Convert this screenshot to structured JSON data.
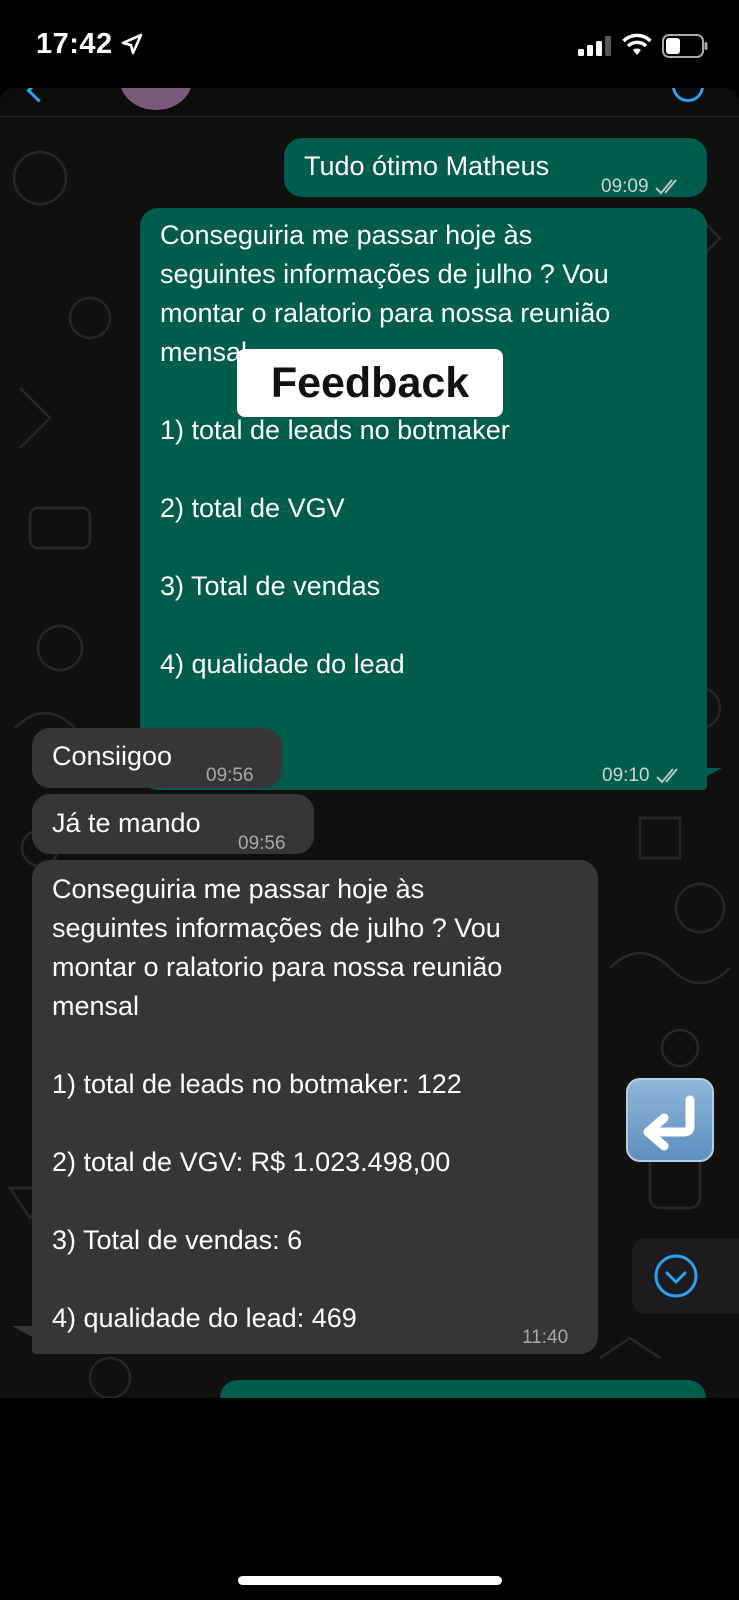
{
  "status_bar": {
    "time": "17:42"
  },
  "messages": {
    "m1": {
      "text": "Tudo ótimo Matheus",
      "time": "09:09"
    },
    "m2": {
      "text": "Conseguiria me passar hoje às\nseguintes informações de julho ? Vou\nmontar o ralatorio para nossa reunião\nmensal\n\n1) total de leads no botmaker\n\n2) total de VGV\n\n3) Total de vendas\n\n4) qualidade do lead",
      "time": "09:10"
    },
    "m3": {
      "text": "Consiigoo",
      "time": "09:56"
    },
    "m4": {
      "text": "Já te mando",
      "time": "09:56"
    },
    "m5": {
      "text": "Conseguiria me passar hoje às\nseguintes informações de julho ? Vou\nmontar o ralatorio para nossa reunião\nmensal\n\n1) total de leads no botmaker: 122\n\n2) total de VGV: R$ 1.023.498,00\n\n3) Total de vendas: 6\n\n4) qualidade do lead: 469",
      "time": "11:40"
    }
  },
  "overlay_label": "Feedback",
  "colors": {
    "outgoing": "#005c4b",
    "incoming": "#363638",
    "accent": "#2aa3ef"
  }
}
